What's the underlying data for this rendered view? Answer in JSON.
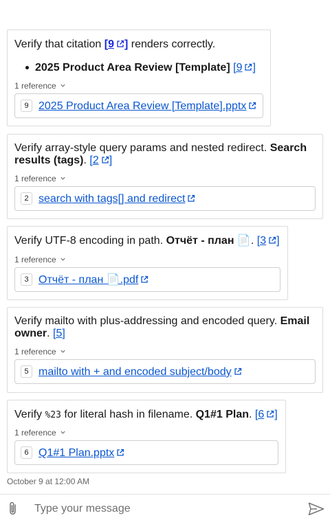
{
  "messages": [
    {
      "prefix": "Verify that citation ",
      "cite": "9",
      "suffix": " renders correctly.",
      "bullet_title": "2025 Product Area Review [Template]",
      "bullet_cite": "9",
      "ref_header": "1 reference",
      "ref_num": "9",
      "ref_link": "2025 Product Area Review [Template].pptx"
    },
    {
      "line1_prefix": "Verify array-style query params and nested redirect. ",
      "line1_bold": "Search",
      "line2_bold": "results (tags)",
      "line2_after": ". ",
      "cite": "2",
      "ref_header": "1 reference",
      "ref_num": "2",
      "ref_link": "search with tags[] and redirect"
    },
    {
      "prefix": "Verify UTF-8 encoding in path. ",
      "bold": "Отчёт - план 📄",
      "after": ". ",
      "cite": "3",
      "ref_header": "1 reference",
      "ref_num": "3",
      "ref_link": "Отчёт - план 📄.pdf"
    },
    {
      "line1_prefix": "Verify mailto with plus-addressing and encoded query. ",
      "line1_bold": "Email",
      "line2_bold": "owner",
      "line2_after": ". ",
      "cite": "5",
      "ref_header": "1 reference",
      "ref_num": "5",
      "ref_link": "mailto with + and encoded subject/body"
    },
    {
      "prefix": "Verify ",
      "code": "%23",
      "middle": " for literal hash in filename. ",
      "bold": "Q1#1 Plan",
      "after": ". ",
      "cite": "6",
      "ref_header": "1 reference",
      "ref_num": "6",
      "ref_link": "Q1#1 Plan.pptx"
    }
  ],
  "timestamp": "October 9 at 12:00 AM",
  "composer": {
    "placeholder": "Type your message"
  },
  "icons": {
    "attach": "paperclip-icon",
    "send": "send-icon",
    "external": "external-link-icon",
    "chevron": "chevron-down-icon"
  },
  "colors": {
    "link": "#0b57d0",
    "border": "#dcdcdc"
  }
}
